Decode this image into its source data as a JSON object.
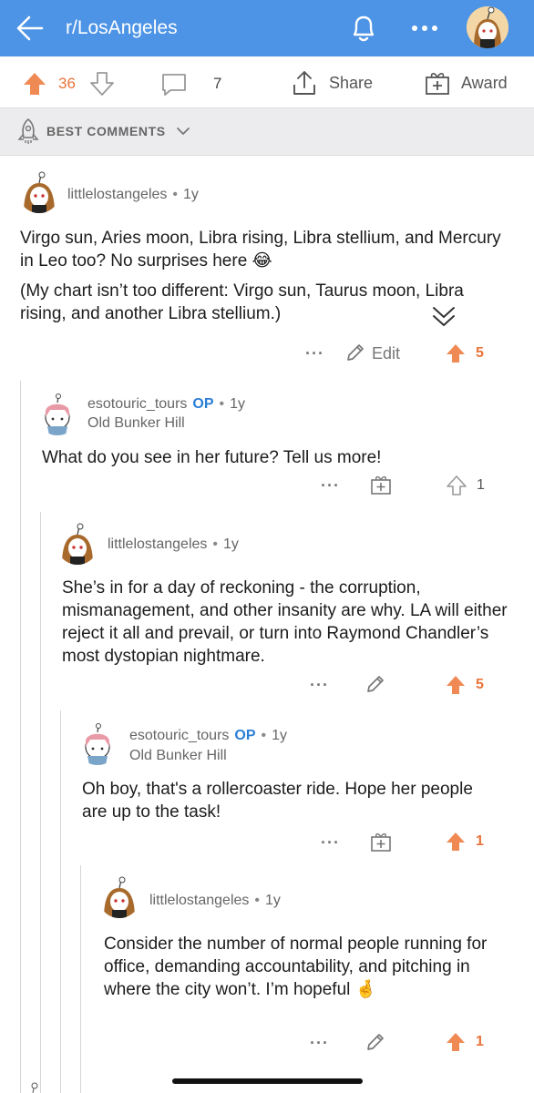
{
  "header": {
    "title": "r/LosAngeles"
  },
  "actions": {
    "upvote_count": "36",
    "comment_count": "7",
    "share_label": "Share",
    "award_label": "Award"
  },
  "sort": {
    "label": "BEST COMMENTS"
  },
  "comments": [
    {
      "author": "littlelostangeles",
      "op": "",
      "age": "1y",
      "flair": "",
      "paragraphs": [
        "Virgo sun, Aries moon, Libra rising, Libra stellium, and Mercury in Leo too? No surprises here 😂",
        "(My chart isn’t too different: Virgo sun, Taurus moon, Libra rising, and another Libra stellium.)"
      ],
      "edit_label": "Edit",
      "votes": "5"
    },
    {
      "author": "esotouric_tours",
      "op": "OP",
      "age": "1y",
      "flair": "Old Bunker Hill",
      "paragraphs": [
        "What do you see in her future? Tell us more!"
      ],
      "votes": "1"
    },
    {
      "author": "littlelostangeles",
      "op": "",
      "age": "1y",
      "flair": "",
      "paragraphs": [
        "She’s in for a day of reckoning - the corruption, mismanagement, and other insanity are why. LA will either reject it all and prevail, or turn into Raymond Chandler’s most dystopian nightmare."
      ],
      "votes": "5"
    },
    {
      "author": "esotouric_tours",
      "op": "OP",
      "age": "1y",
      "flair": "Old Bunker Hill",
      "paragraphs": [
        "Oh boy, that's a rollercoaster ride. Hope her people are up to the task!"
      ],
      "votes": "1"
    },
    {
      "author": "littlelostangeles",
      "op": "",
      "age": "1y",
      "flair": "",
      "paragraphs": [
        "Consider the number of normal people running for office, demanding accountability, and pitching in where the city won’t. I’m hopeful 🤞"
      ],
      "votes": "1"
    }
  ],
  "colors": {
    "header_bg": "#4d94e6",
    "upvote_orange": "#e9743a",
    "op_blue": "#2c7fd6"
  },
  "icons": [
    "back-arrow-icon",
    "bell-icon",
    "more-icon",
    "user-avatar",
    "upvote-icon",
    "downvote-icon",
    "comment-icon",
    "share-icon",
    "award-icon",
    "rocket-icon",
    "chevron-down-icon",
    "collapse-chevron-icon",
    "pencil-icon"
  ]
}
